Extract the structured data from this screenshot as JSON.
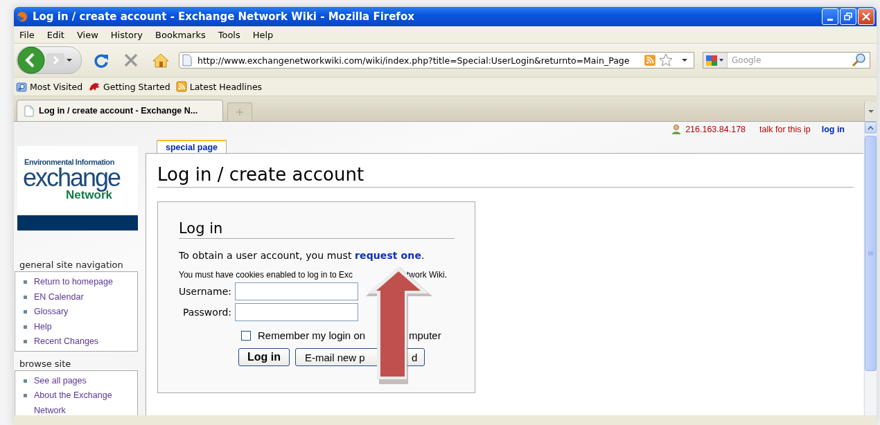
{
  "window": {
    "title": "Log in / create account - Exchange Network Wiki - Mozilla Firefox"
  },
  "menu": [
    "File",
    "Edit",
    "View",
    "History",
    "Bookmarks",
    "Tools",
    "Help"
  ],
  "address": {
    "url": "http://www.exchangenetworkwiki.com/wiki/index.php?title=Special:UserLogin&returnto=Main_Page"
  },
  "search": {
    "placeholder": "Google"
  },
  "bookmarks": [
    "Most Visited",
    "Getting Started",
    "Latest Headlines"
  ],
  "tabs": [
    {
      "label": "Log in / create account - Exchange N...",
      "selected": true
    }
  ],
  "personal": {
    "ip": "216.163.84.178",
    "talk": "talk for this ip",
    "login": "log in"
  },
  "logo": {
    "top": "Environmental Information",
    "main": "exchange",
    "sub": "Network"
  },
  "sidebar": [
    {
      "heading": "general site navigation",
      "items": [
        "Return to homepage",
        "EN Calendar",
        "Glossary",
        "Help",
        "Recent Changes"
      ]
    },
    {
      "heading": "browse site",
      "items": [
        "See all pages",
        "About the Exchange Network"
      ]
    }
  ],
  "content_tab": {
    "label": "special page",
    "selected": true
  },
  "page_title": "Log in / create account",
  "login": {
    "heading": "Log in",
    "intro": "To obtain a user account, you must ",
    "link": "request one",
    "intro_end": ".",
    "cookies": [
      "You must have cookies enabled to log in to Exc",
      "twork Wiki."
    ],
    "fields": [
      {
        "label": "Username:"
      },
      {
        "label": "Password:"
      }
    ],
    "remember": {
      "parts": [
        "Remember my login on",
        "mputer"
      ],
      "checked": false
    },
    "buttons": [
      {
        "parts": [
          "Log in"
        ],
        "kind": "primary"
      },
      {
        "parts": [
          "E-mail new p",
          "d"
        ],
        "kind": "secondary"
      }
    ]
  }
}
